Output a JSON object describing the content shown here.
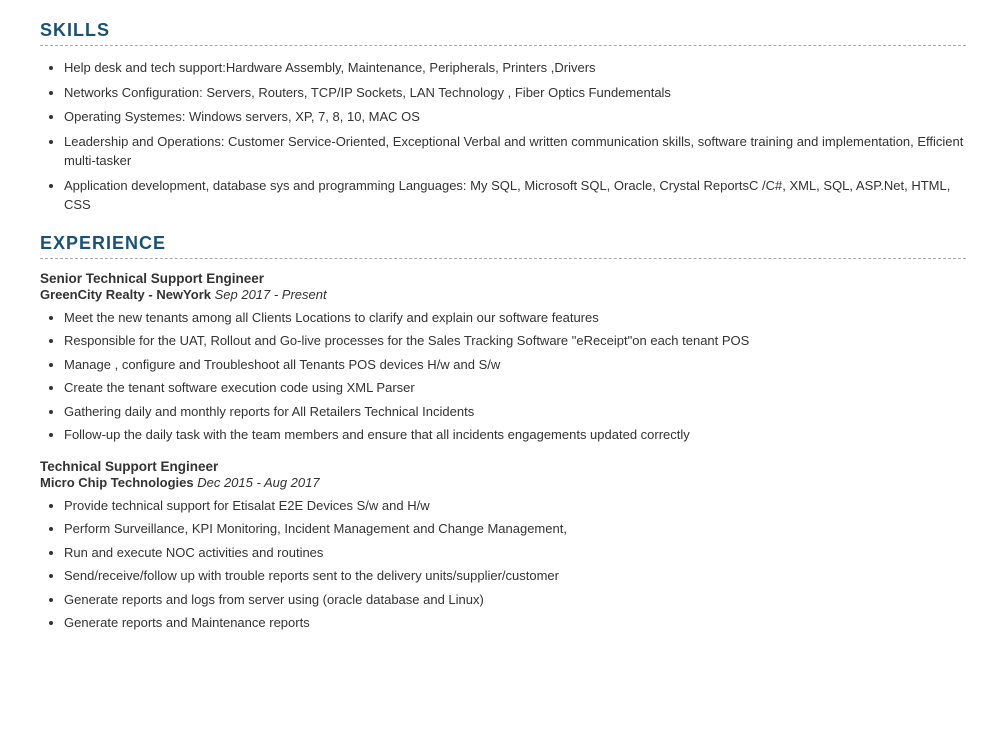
{
  "skills": {
    "heading": "SKILLS",
    "items": [
      "Help desk and tech support:Hardware Assembly, Maintenance, Peripherals, Printers ,Drivers",
      "Networks Configuration: Servers, Routers, TCP/IP Sockets, LAN Technology , Fiber Optics Fundementals",
      "Operating Systemes: Windows servers, XP, 7, 8, 10, MAC OS",
      "Leadership and Operations: Customer Service-Oriented, Exceptional Verbal and written communication skills, software training and implementation, Efficient multi-tasker",
      "Application development, database sys and programming Languages: My SQL, Microsoft SQL, Oracle, Crystal ReportsC /C#, XML, SQL, ASP.Net, HTML, CSS"
    ]
  },
  "experience": {
    "heading": "EXPERIENCE",
    "jobs": [
      {
        "title": "Senior Technical Support Engineer",
        "company": "GreenCity Realty - NewYork",
        "date": "Sep 2017 - Present",
        "bullets": [
          "Meet the new tenants among all Clients Locations to clarify and explain our software features",
          "Responsible for the UAT, Rollout and Go-live processes for the Sales Tracking Software \"eReceipt\"on each tenant POS",
          "Manage , configure and Troubleshoot all Tenants POS devices H/w and S/w",
          "Create the tenant software execution code using XML Parser",
          "Gathering daily and monthly reports for All Retailers Technical Incidents",
          "Follow-up the daily task with the team members and ensure that all incidents engagements updated correctly"
        ]
      },
      {
        "title": "Technical Support Engineer",
        "company": "Micro Chip Technologies",
        "date": "Dec 2015 - Aug 2017",
        "bullets": [
          "Provide technical support for Etisalat E2E Devices S/w and H/w",
          "Perform Surveillance, KPI Monitoring, Incident Management and Change Management,",
          "Run and execute NOC activities and routines",
          "Send/receive/follow up with trouble reports sent to the delivery units/supplier/customer",
          "Generate reports and logs from server using (oracle database and Linux)",
          "Generate reports and Maintenance reports"
        ]
      }
    ]
  }
}
